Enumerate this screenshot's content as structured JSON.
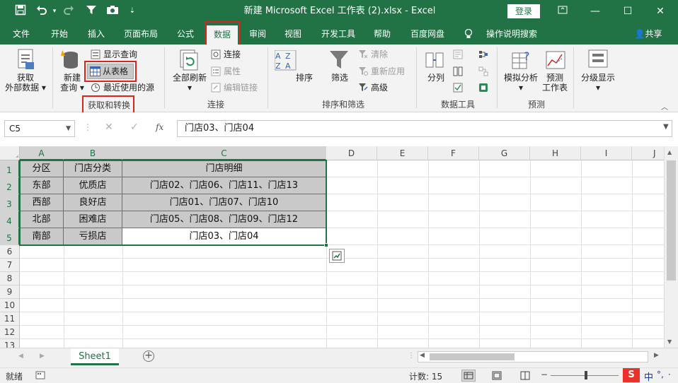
{
  "titlebar": {
    "title": "新建 Microsoft Excel 工作表 (2).xlsx  -  Excel",
    "login_label": "登录",
    "save_icon": "save-icon",
    "undo_icon": "undo-icon",
    "redo_icon": "redo-icon",
    "filter_icon": "filter-icon",
    "camera_icon": "camera-icon",
    "customize_icon": "customize-qat-icon",
    "window_controls": [
      "ribbon-display-icon",
      "minimize-icon",
      "maximize-icon",
      "close-icon"
    ]
  },
  "tabs": [
    {
      "label": "文件"
    },
    {
      "label": "开始"
    },
    {
      "label": "插入"
    },
    {
      "label": "页面布局"
    },
    {
      "label": "公式"
    },
    {
      "label": "数据",
      "active": true
    },
    {
      "label": "审阅"
    },
    {
      "label": "视图"
    },
    {
      "label": "开发工具"
    },
    {
      "label": "帮助"
    },
    {
      "label": "百度网盘"
    },
    {
      "label": "操作说明搜索"
    }
  ],
  "share_label": "共享",
  "ribbon": {
    "get_external": {
      "line1": "获取",
      "line2": "外部数据"
    },
    "new_query": {
      "line1": "新建",
      "line2": "查询"
    },
    "show_queries": "显示查询",
    "from_table": "从表格",
    "recent_sources": "最近使用的源",
    "group_get_transform": "获取和转换",
    "refresh_all": "全部刷新",
    "connections": "连接",
    "properties": "属性",
    "edit_links": "编辑链接",
    "group_connections": "连接",
    "sort": "排序",
    "filter": "筛选",
    "clear": "清除",
    "reapply": "重新应用",
    "advanced": "高级",
    "group_sort_filter": "排序和筛选",
    "text_to_columns": "分列",
    "group_data_tools": "数据工具",
    "what_if": "模拟分析",
    "forecast_sheet": {
      "line1": "预测",
      "line2": "工作表"
    },
    "group_forecast": "预测",
    "outline": "分级显示"
  },
  "formula_bar": {
    "name_box": "C5",
    "fx": "fx",
    "formula": "门店03、门店04"
  },
  "grid": {
    "columns": [
      "A",
      "B",
      "C",
      "D",
      "E",
      "F",
      "G",
      "H",
      "I",
      "J"
    ],
    "rows": [
      "1",
      "2",
      "3",
      "4",
      "5",
      "6",
      "7",
      "8",
      "9",
      "10",
      "11",
      "12",
      "13"
    ],
    "table": [
      [
        "分区",
        "门店分类",
        "门店明细"
      ],
      [
        "东部",
        "优质店",
        "门店02、门店06、门店11、门店13"
      ],
      [
        "西部",
        "良好店",
        "门店01、门店07、门店10"
      ],
      [
        "北部",
        "困难店",
        "门店05、门店08、门店09、门店12"
      ],
      [
        "南部",
        "亏损店",
        "门店03、门店04"
      ]
    ]
  },
  "sheet_tabs": [
    "Sheet1"
  ],
  "status": {
    "ready": "就绪",
    "count": "计数: 15"
  },
  "colors": {
    "excel_green": "#217346",
    "highlight_red": "#d9261c",
    "selected_cell_fill": "#c9c9c9"
  }
}
